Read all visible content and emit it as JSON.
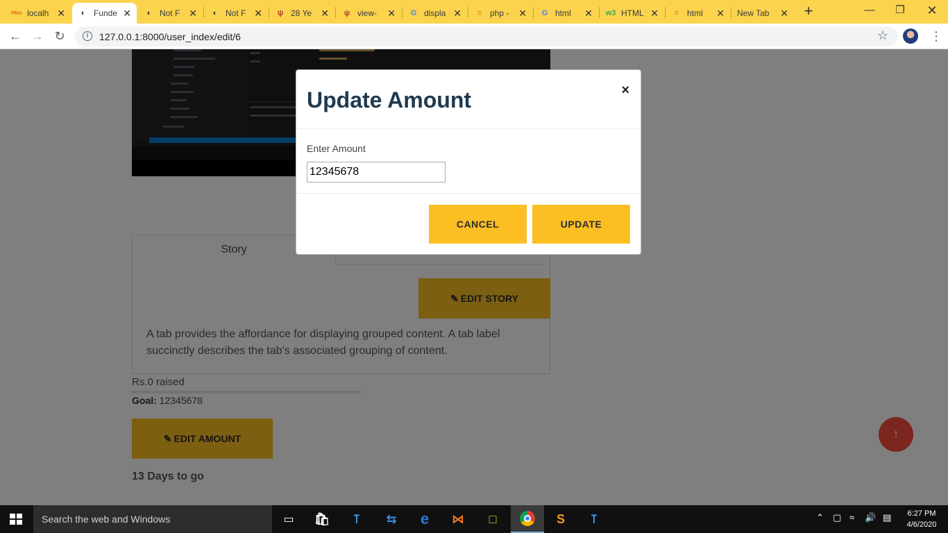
{
  "browser": {
    "tabs": [
      {
        "label": "localh",
        "icon": "pma-icon",
        "glyph": "PMA",
        "color": "#e56a1e"
      },
      {
        "label": "Funde",
        "icon": "globe-icon",
        "glyph": "◐",
        "color": "#333333",
        "active": true
      },
      {
        "label": "Not F",
        "icon": "globe-icon",
        "glyph": "◐",
        "color": "#333333"
      },
      {
        "label": "Not F",
        "icon": "globe-icon",
        "glyph": "◐",
        "color": "#333333"
      },
      {
        "label": "28 Ye",
        "icon": "laracasts-icon",
        "glyph": "ψ",
        "color": "#b23c2a"
      },
      {
        "label": "view-",
        "icon": "laracasts-icon",
        "glyph": "ψ",
        "color": "#b23c2a"
      },
      {
        "label": "displa",
        "icon": "google-icon",
        "glyph": "G",
        "color": "#4285f4"
      },
      {
        "label": "php -",
        "icon": "stackoverflow-icon",
        "glyph": "≡",
        "color": "#e87922"
      },
      {
        "label": "html",
        "icon": "google-icon",
        "glyph": "G",
        "color": "#4285f4"
      },
      {
        "label": "HTML",
        "icon": "w3schools-icon",
        "glyph": "w3",
        "color": "#3fa84a"
      },
      {
        "label": "html",
        "icon": "stackoverflow-icon",
        "glyph": "≡",
        "color": "#e87922"
      },
      {
        "label": "New Tab",
        "icon": "",
        "glyph": "",
        "color": "#333333"
      }
    ],
    "url": "127.0.0.1:8000/user_index/edit/6"
  },
  "page": {
    "story_tab": "Story",
    "edit_story_label": "EDIT STORY",
    "story_text": "A tab provides the affordance for displaying grouped content. A tab label succinctly describes the tab's associated grouping of content.",
    "raised": "Rs.0 raised",
    "raised_fraction": 0,
    "goal_label": "Goal:",
    "goal_value": "12345678",
    "edit_amount_label": "EDIT AMOUNT",
    "days_to_go": "13 Days to go"
  },
  "modal": {
    "title": "Update Amount",
    "close": "×",
    "amount_label": "Enter Amount",
    "amount_value": "12345678",
    "cancel_label": "CANCEL",
    "update_label": "UPDATE"
  },
  "taskbar": {
    "search_placeholder": "Search the web and Windows",
    "time": "6:27 PM",
    "date": "4/6/2020"
  },
  "colors": {
    "accent": "#fbbf24",
    "chrome_frame": "#fbd34d",
    "title": "#1f3a4f",
    "scroll_top": "#f74c3c"
  }
}
